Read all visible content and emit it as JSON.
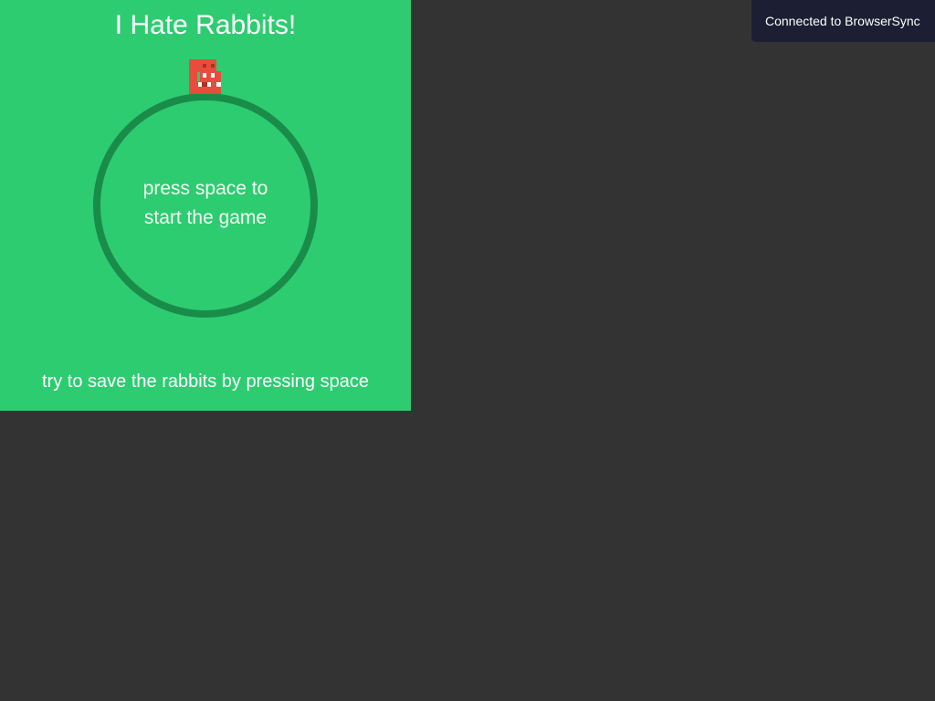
{
  "game": {
    "title": "I Hate Rabbits!",
    "start_prompt": {
      "line1": "press space to",
      "line2": "start the game"
    },
    "instructions": "try to save the rabbits by pressing space",
    "colors": {
      "background": "#2ecc71",
      "ring": "#1a8c4a",
      "monster": "#e74c3c",
      "teeth": "#ffffff",
      "page_background": "#333333"
    },
    "monster_icon": "red-block-monster"
  },
  "browsersync": {
    "message": "Connected to BrowserSync"
  }
}
